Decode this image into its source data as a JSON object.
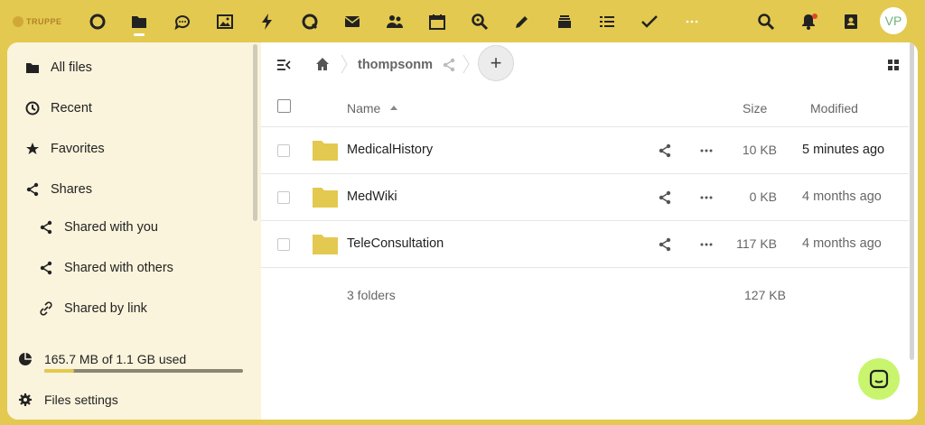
{
  "app": {
    "logo_text": "TRUPPE",
    "avatar_initials": "VP",
    "accent_color": "#e3c94f",
    "chat_button_color": "#c9f56e"
  },
  "topbar": {
    "apps": [
      {
        "name": "dashboard-icon"
      },
      {
        "name": "files-icon",
        "active": true
      },
      {
        "name": "talk-icon"
      },
      {
        "name": "photos-icon"
      },
      {
        "name": "activity-icon"
      },
      {
        "name": "search-app-icon"
      },
      {
        "name": "mail-icon"
      },
      {
        "name": "contacts-icon"
      },
      {
        "name": "calendar-icon"
      },
      {
        "name": "find-icon"
      },
      {
        "name": "notes-icon"
      },
      {
        "name": "deck-icon"
      },
      {
        "name": "list-icon"
      },
      {
        "name": "tasks-icon"
      },
      {
        "name": "more-apps-icon"
      }
    ],
    "right_icons": [
      "search-icon",
      "notifications-icon",
      "contacts-menu-icon"
    ]
  },
  "sidebar": {
    "items": [
      {
        "label": "All files",
        "icon": "folder-icon"
      },
      {
        "label": "Recent",
        "icon": "clock-icon"
      },
      {
        "label": "Favorites",
        "icon": "star-icon"
      },
      {
        "label": "Shares",
        "icon": "share-icon"
      },
      {
        "label": "Shared with you",
        "icon": "share-icon"
      },
      {
        "label": "Shared with others",
        "icon": "share-icon"
      },
      {
        "label": "Shared by link",
        "icon": "link-icon"
      }
    ],
    "quota": {
      "label": "165.7 MB of 1.1 GB used",
      "fraction": 0.15
    },
    "settings_label": "Files settings"
  },
  "breadcrumb": {
    "home_icon": "home-icon",
    "user": "thompsonm",
    "add_label": "+"
  },
  "table": {
    "headers": {
      "name": "Name",
      "size": "Size",
      "modified": "Modified"
    },
    "sort": {
      "column": "name",
      "direction": "ascending"
    },
    "rows": [
      {
        "name": "MedicalHistory",
        "size": "10 KB",
        "modified": "5 minutes ago"
      },
      {
        "name": "MedWiki",
        "size": "0 KB",
        "modified": "4 months ago"
      },
      {
        "name": "TeleConsultation",
        "size": "117 KB",
        "modified": "4 months ago"
      }
    ],
    "summary": {
      "count": "3 folders",
      "size": "127 KB"
    }
  }
}
